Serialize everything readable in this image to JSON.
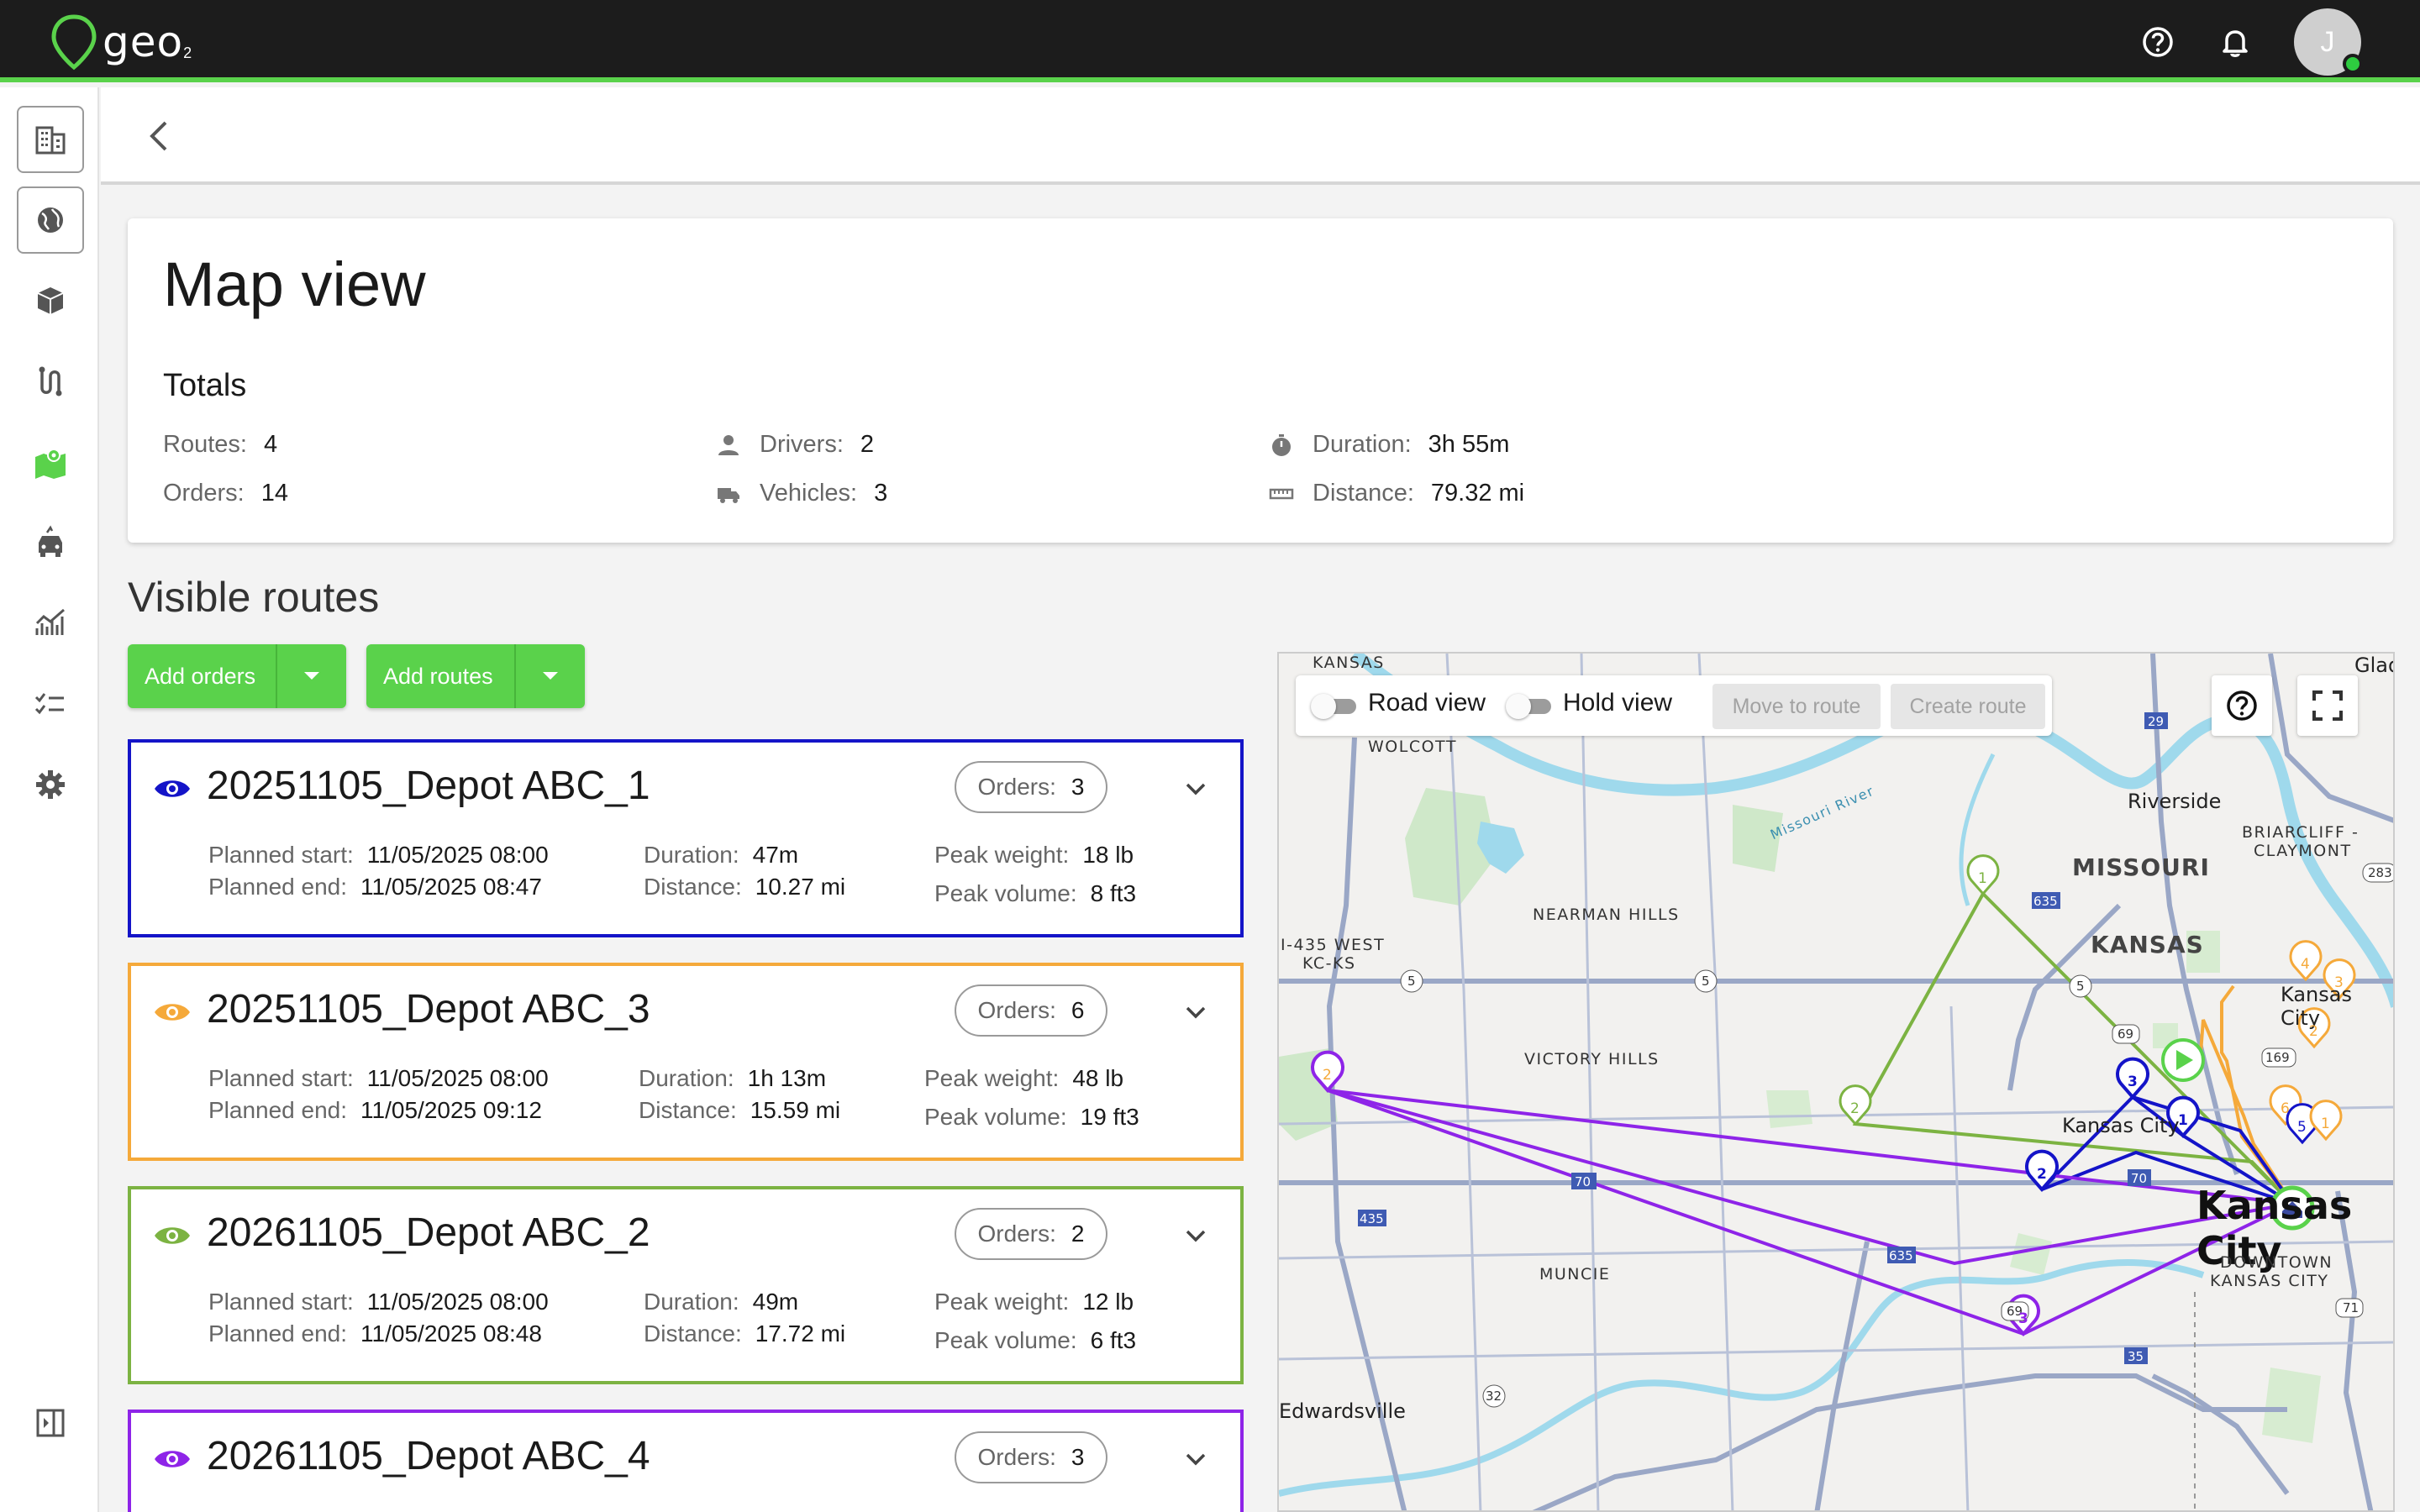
{
  "app": {
    "logo_text": "geo",
    "logo_sub": "2",
    "avatar_initial": "J"
  },
  "header": {
    "title": "Map view"
  },
  "totals": {
    "heading": "Totals",
    "routes_label": "Routes:",
    "routes_value": "4",
    "orders_label": "Orders:",
    "orders_value": "14",
    "drivers_label": "Drivers:",
    "drivers_value": "2",
    "vehicles_label": "Vehicles:",
    "vehicles_value": "3",
    "duration_label": "Duration:",
    "duration_value": "3h 55m",
    "distance_label": "Distance:",
    "distance_value": "79.32 mi"
  },
  "visible_routes": {
    "heading": "Visible routes",
    "add_orders": "Add orders",
    "add_routes": "Add routes"
  },
  "labels": {
    "orders": "Orders:",
    "planned_start": "Planned start:",
    "planned_end": "Planned end:",
    "duration": "Duration:",
    "distance": "Distance:",
    "peak_weight": "Peak weight:",
    "peak_volume": "Peak volume:"
  },
  "routes": [
    {
      "name": "20251105_Depot ABC_1",
      "color": "#1414c8",
      "orders": "3",
      "planned_start": "11/05/2025 08:00",
      "planned_end": "11/05/2025 08:47",
      "duration": "47m",
      "distance": "10.27 mi",
      "peak_weight": "18 lb",
      "peak_volume": "8 ft3"
    },
    {
      "name": "20251105_Depot ABC_3",
      "color": "#f5a93a",
      "orders": "6",
      "planned_start": "11/05/2025 08:00",
      "planned_end": "11/05/2025 09:12",
      "duration": "1h 13m",
      "distance": "15.59 mi",
      "peak_weight": "48 lb",
      "peak_volume": "19 ft3"
    },
    {
      "name": "20261105_Depot ABC_2",
      "color": "#7cb342",
      "orders": "2",
      "planned_start": "11/05/2025 08:00",
      "planned_end": "11/05/2025 08:48",
      "duration": "49m",
      "distance": "17.72 mi",
      "peak_weight": "12 lb",
      "peak_volume": "6 ft3"
    },
    {
      "name": "20261105_Depot ABC_4",
      "color": "#8e24e8",
      "orders": "3"
    }
  ],
  "map": {
    "road_view": "Road view",
    "hold_view": "Hold view",
    "move_to_route": "Move to route",
    "create_route": "Create route",
    "places": {
      "kansas_top": "KANSAS",
      "glad": "Glad",
      "wolcott": "WOLCOTT",
      "riverside": "Riverside",
      "briarcliff_1": "BRIARCLIFF -",
      "briarcliff_2": "CLAYMONT",
      "missouri": "MISSOURI",
      "nearman": "NEARMAN HILLS",
      "i435_1": "I-435 WEST",
      "i435_2": "KC-KS",
      "kansas": "KANSAS",
      "kansas_city_small": "Kansas City",
      "victory": "VICTORY HILLS",
      "kansas_city_mid": "Kansas City",
      "kansas_city_big": "Kansas City",
      "muncie": "MUNCIE",
      "downtown_1": "DOWNTOWN",
      "downtown_2": "KANSAS CITY",
      "edwardsville": "Edwardsville",
      "river": "Missouri River"
    },
    "shields": [
      "29",
      "635",
      "283",
      "5",
      "5",
      "5",
      "69",
      "169",
      "70",
      "435",
      "635",
      "69",
      "35",
      "32",
      "71",
      "70"
    ],
    "pins": [
      "1",
      "2",
      "3",
      "1",
      "2",
      "2",
      "3",
      "4",
      "3",
      "2",
      "6",
      "5",
      "1",
      "2"
    ]
  }
}
